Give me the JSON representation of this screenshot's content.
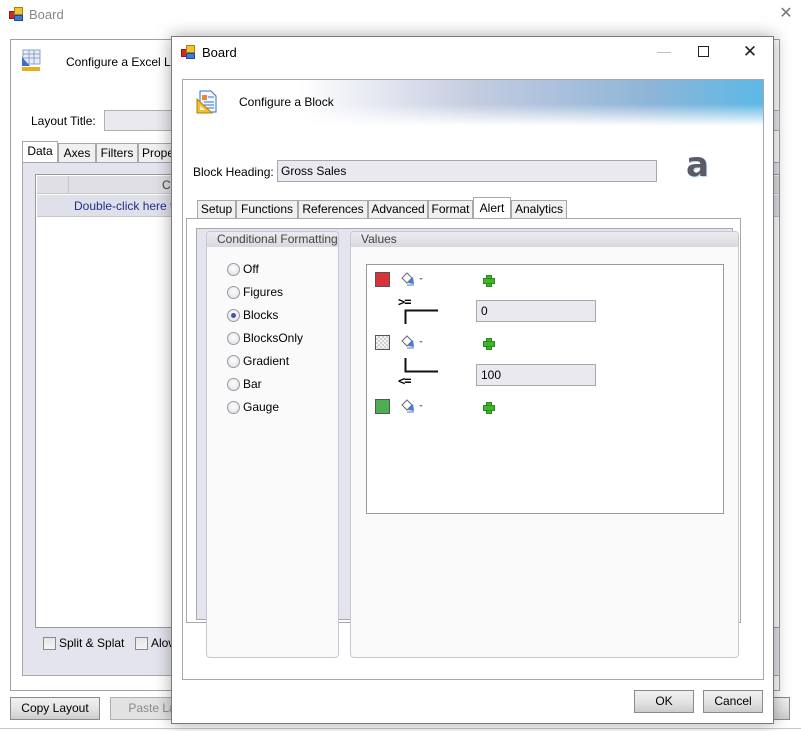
{
  "background_window": {
    "title": "Board",
    "header_text": "Configure a Excel Layo",
    "layout_title_label": "Layout Title:",
    "layout_title_value": "",
    "tabs": [
      {
        "label": "Data",
        "active": true
      },
      {
        "label": "Axes",
        "active": false
      },
      {
        "label": "Filters",
        "active": false
      },
      {
        "label": "Prope",
        "active": false
      }
    ],
    "grid_header_text": "Co",
    "grid_add_row_text": "Double-click here to",
    "checkboxes": [
      {
        "label": "Split & Splat",
        "checked": false
      },
      {
        "label": "Alow",
        "checked": false
      }
    ],
    "buttons": {
      "copy_layout": "Copy Layout",
      "paste_layout": "Paste Lay"
    }
  },
  "dialog": {
    "title": "Board",
    "header_text": "Configure a Block",
    "block_heading_label": "Block Heading:",
    "block_heading_value": "Gross Sales",
    "logo_glyph": "a",
    "tabs": [
      {
        "label": "Setup",
        "active": false
      },
      {
        "label": "Functions",
        "active": false
      },
      {
        "label": "References",
        "active": false
      },
      {
        "label": "Advanced",
        "active": false
      },
      {
        "label": "Format",
        "active": false
      },
      {
        "label": "Alert",
        "active": true
      },
      {
        "label": "Analytics",
        "active": false
      }
    ],
    "conditional_formatting": {
      "title": "Conditional Formatting",
      "options": [
        {
          "label": "Off",
          "checked": false
        },
        {
          "label": "Figures",
          "checked": false
        },
        {
          "label": "Blocks",
          "checked": true
        },
        {
          "label": "BlocksOnly",
          "checked": false
        },
        {
          "label": "Gradient",
          "checked": false
        },
        {
          "label": "Bar",
          "checked": false
        },
        {
          "label": "Gauge",
          "checked": false
        }
      ]
    },
    "values": {
      "title": "Values",
      "colors": [
        {
          "name": "red",
          "hex": "#d9323a"
        },
        {
          "name": "transparent",
          "hex": "#e8e8e8"
        },
        {
          "name": "green",
          "hex": "#4caf50"
        }
      ],
      "thresholds": [
        {
          "operator": ">=",
          "value": "0"
        },
        {
          "operator": "<=",
          "value": "100"
        }
      ]
    },
    "buttons": {
      "ok": "OK",
      "cancel": "Cancel"
    }
  }
}
